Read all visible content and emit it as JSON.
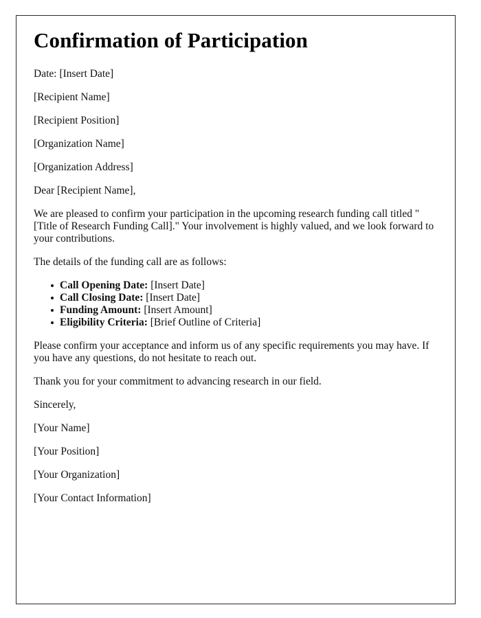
{
  "document": {
    "title": "Confirmation of Participation",
    "date_line": "Date: [Insert Date]",
    "recipient": {
      "name": "[Recipient Name]",
      "position": "[Recipient Position]",
      "organization": "[Organization Name]",
      "address": "[Organization Address]"
    },
    "salutation": "Dear [Recipient Name],",
    "intro_paragraph": "We are pleased to confirm your participation in the upcoming research funding call titled \"[Title of Research Funding Call].\" Your involvement is highly valued, and we look forward to your contributions.",
    "details_intro": "The details of the funding call are as follows:",
    "details": [
      {
        "label": "Call Opening Date:",
        "value": "[Insert Date]"
      },
      {
        "label": "Call Closing Date:",
        "value": "[Insert Date]"
      },
      {
        "label": "Funding Amount:",
        "value": "[Insert Amount]"
      },
      {
        "label": "Eligibility Criteria:",
        "value": "[Brief Outline of Criteria]"
      }
    ],
    "confirm_paragraph": "Please confirm your acceptance and inform us of any specific requirements you may have. If you have any questions, do not hesitate to reach out.",
    "thanks_paragraph": "Thank you for your commitment to advancing research in our field.",
    "closing": "Sincerely,",
    "signature": {
      "name": "[Your Name]",
      "position": "[Your Position]",
      "organization": "[Your Organization]",
      "contact": "[Your Contact Information]"
    }
  },
  "style": {
    "page_background": "#ffffff",
    "border_color": "#2b2b2b",
    "text_color": "#111111"
  }
}
